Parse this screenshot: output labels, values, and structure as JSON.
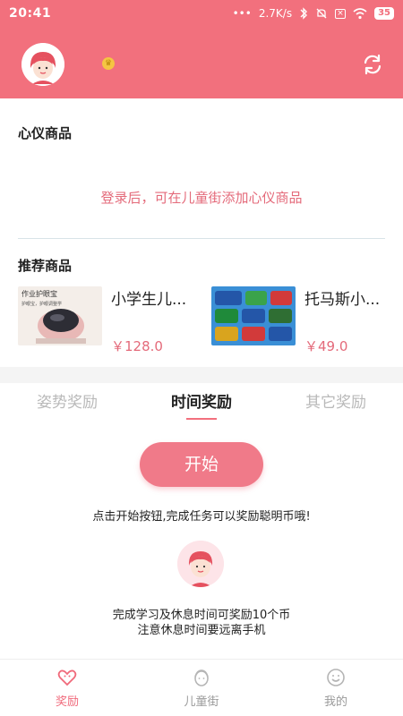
{
  "status_bar": {
    "time": "20:41",
    "network_speed": "2.7K/s",
    "battery": "35",
    "icons": [
      "dots-icon",
      "bluetooth-icon",
      "mute-icon",
      "sim-icon",
      "wifi-icon",
      "battery-icon"
    ]
  },
  "header": {
    "avatar_icon": "girl-avatar-icon",
    "badge_icon": "crown-badge-icon",
    "refresh_icon": "refresh-icon",
    "accent": "#f2707d"
  },
  "favorites": {
    "title": "心仪商品",
    "empty_message": "登录后，可在儿童街添加心仪商品"
  },
  "recommended": {
    "title": "推荐商品",
    "items": [
      {
        "name": "小学生儿...",
        "price": "￥128.0",
        "thumb_text": "作业护眼宝",
        "thumb_sub": "护眼宝，护眼调整学"
      },
      {
        "name": "托马斯小...",
        "price": "￥49.0"
      }
    ]
  },
  "reward_tabs": [
    {
      "label": "姿势奖励"
    },
    {
      "label": "时间奖励"
    },
    {
      "label": "其它奖励"
    }
  ],
  "time_reward": {
    "start_label": "开始",
    "hint": "点击开始按钮,完成任务可以奖励聪明币哦!",
    "info_line1": "完成学习及休息时间可奖励10个币",
    "info_line2": "注意休息时间要远离手机"
  },
  "bottom_nav": [
    {
      "label": "奖励",
      "icon": "reward-heart-icon"
    },
    {
      "label": "儿童街",
      "icon": "kid-face-icon"
    },
    {
      "label": "我的",
      "icon": "smile-face-icon"
    }
  ]
}
